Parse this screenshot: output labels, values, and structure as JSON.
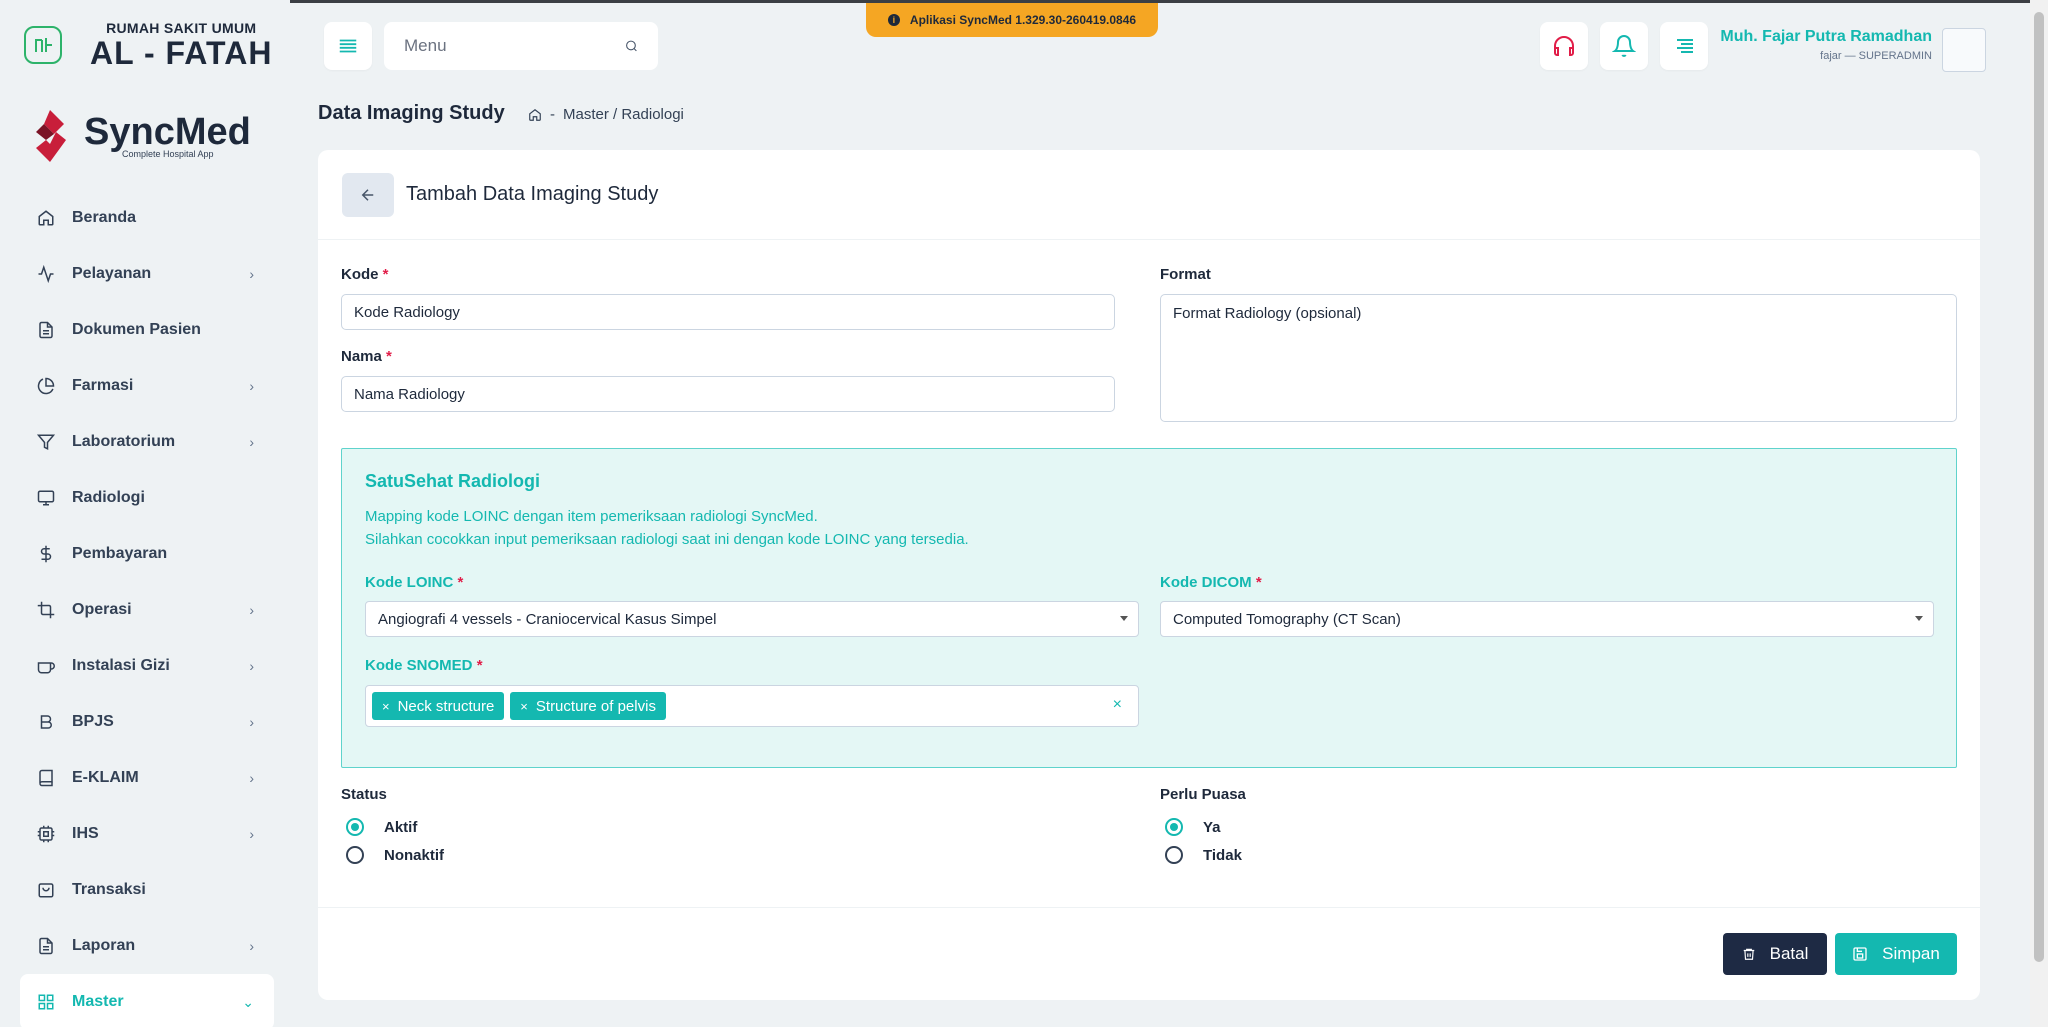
{
  "hospital": {
    "subtitle": "RUMAH SAKIT UMUM",
    "name": "AL - FATAH"
  },
  "brand": {
    "name": "SyncMed",
    "tagline": "Complete Hospital App"
  },
  "sidebar": {
    "items": [
      {
        "label": "Beranda",
        "icon": "home-icon",
        "expandable": false
      },
      {
        "label": "Pelayanan",
        "icon": "activity-icon",
        "expandable": true
      },
      {
        "label": "Dokumen Pasien",
        "icon": "document-icon",
        "expandable": false
      },
      {
        "label": "Farmasi",
        "icon": "pie-chart-icon",
        "expandable": true
      },
      {
        "label": "Laboratorium",
        "icon": "filter-icon",
        "expandable": true
      },
      {
        "label": "Radiologi",
        "icon": "monitor-icon",
        "expandable": false
      },
      {
        "label": "Pembayaran",
        "icon": "dollar-icon",
        "expandable": false
      },
      {
        "label": "Operasi",
        "icon": "crop-icon",
        "expandable": true
      },
      {
        "label": "Instalasi Gizi",
        "icon": "coffee-icon",
        "expandable": true
      },
      {
        "label": "BPJS",
        "icon": "bold-b-icon",
        "expandable": true
      },
      {
        "label": "E-KLAIM",
        "icon": "book-icon",
        "expandable": true
      },
      {
        "label": "IHS",
        "icon": "cpu-icon",
        "expandable": true
      },
      {
        "label": "Transaksi",
        "icon": "shopping-bag-icon",
        "expandable": false
      },
      {
        "label": "Laporan",
        "icon": "document-icon",
        "expandable": true
      },
      {
        "label": "Master",
        "icon": "grid-icon",
        "expandable": true,
        "active": true
      }
    ]
  },
  "header": {
    "search_placeholder": "Menu",
    "version": "Aplikasi SyncMed 1.329.30-260419.0846",
    "user_name": "Muh. Fajar Putra Ramadhan",
    "user_role": "fajar — SUPERADMIN"
  },
  "page": {
    "title": "Data Imaging Study",
    "breadcrumb_sep": "-",
    "breadcrumb_path": "Master / Radiologi"
  },
  "form": {
    "title": "Tambah Data Imaging Study",
    "kode_label": "Kode",
    "kode_placeholder": "Kode Radiology",
    "nama_label": "Nama",
    "nama_placeholder": "Nama Radiology",
    "format_label": "Format",
    "format_placeholder": "Format Radiology (opsional)",
    "required_mark": "*",
    "satusehat": {
      "title": "SatuSehat Radiologi",
      "desc1": "Mapping kode LOINC dengan item pemeriksaan radiologi SyncMed.",
      "desc2": "Silahkan cocokkan input pemeriksaan radiologi saat ini dengan kode LOINC yang tersedia.",
      "loinc_label": "Kode LOINC",
      "loinc_value": "Angiografi 4 vessels - Craniocervical Kasus Simpel",
      "dicom_label": "Kode DICOM",
      "dicom_value": "Computed Tomography (CT Scan)",
      "snomed_label": "Kode SNOMED",
      "snomed_chips": [
        "Neck structure",
        "Structure of pelvis"
      ],
      "chip_remove": "×",
      "clear": "×"
    },
    "status_label": "Status",
    "status_options": [
      "Aktif",
      "Nonaktif"
    ],
    "status_selected": "Aktif",
    "puasa_label": "Perlu Puasa",
    "puasa_options": [
      "Ya",
      "Tidak"
    ],
    "puasa_selected": "Ya",
    "cancel_label": "Batal",
    "save_label": "Simpan"
  },
  "colors": {
    "accent": "#14b8b0",
    "dark_button": "#1e2a44",
    "version_badge": "#f5a623",
    "required": "#e11d48",
    "notification": "#e11d48"
  }
}
